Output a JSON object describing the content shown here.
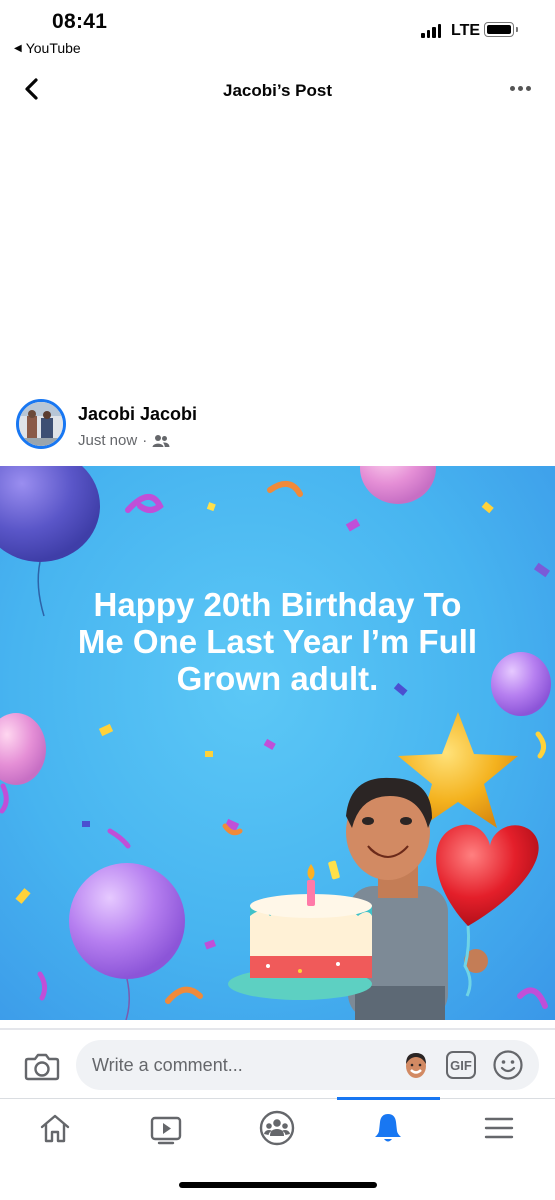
{
  "status_bar": {
    "time": "08:41",
    "back_app": "YouTube",
    "network": "LTE"
  },
  "header": {
    "title": "Jacobi’s Post"
  },
  "post": {
    "author": "Jacobi Jacobi",
    "timestamp": "Just now",
    "separator": "·",
    "audience_icon": "friends-icon",
    "card_background": "#47b4f0",
    "card_text_lines": [
      "Happy 20th Birthday To",
      "Me One Last Year I’m Full",
      "Grown adult."
    ]
  },
  "comment_bar": {
    "placeholder": "Write a comment..."
  },
  "tab_bar": {
    "items": [
      "home-icon",
      "watch-icon",
      "groups-icon",
      "notifications-icon",
      "menu-icon"
    ],
    "active": "notifications-icon",
    "accent": "#1877f2"
  },
  "gif_label": "GIF"
}
